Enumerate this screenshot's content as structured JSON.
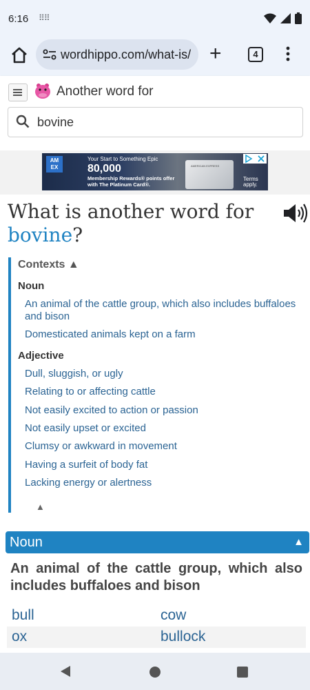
{
  "status": {
    "time": "6:16"
  },
  "browser": {
    "url": "wordhippo.com/what-is/",
    "tab_count": "4"
  },
  "site": {
    "name": "Another word for",
    "search_value": "bovine"
  },
  "ad": {
    "brand": "AM EX",
    "line1": "Your Start to Something Epic",
    "big": "80,000",
    "line3": "Membership Rewards® points offer with The Platinum Card®.",
    "card_text": "AMERICAN EXPRESS",
    "terms": "Terms apply."
  },
  "heading": {
    "prefix": "What is another word for",
    "word": "bovine",
    "suffix": "?"
  },
  "contexts": {
    "title": "Contexts ▲",
    "noun_label": "Noun",
    "noun_items": [
      "An animal of the cattle group, which also includes buffaloes and bison",
      "Domesticated animals kept on a farm"
    ],
    "adjective_label": "Adjective",
    "adjective_items": [
      "Dull, sluggish, or ugly",
      "Relating to or affecting cattle",
      "Not easily excited to action or passion",
      "Not easily upset or excited",
      "Clumsy or awkward in movement",
      "Having a surfeit of body fat",
      "Lacking energy or alertness"
    ],
    "collapse": "▲"
  },
  "section": {
    "label": "Noun",
    "arrow": "▲",
    "definition": "An animal of the cattle group, which also includes buffaloes and bison",
    "synonyms": [
      [
        "bull",
        "cow"
      ],
      [
        "ox",
        "bullock"
      ]
    ]
  },
  "colors": {
    "accent": "#1f83c2",
    "link": "#2a6393"
  }
}
